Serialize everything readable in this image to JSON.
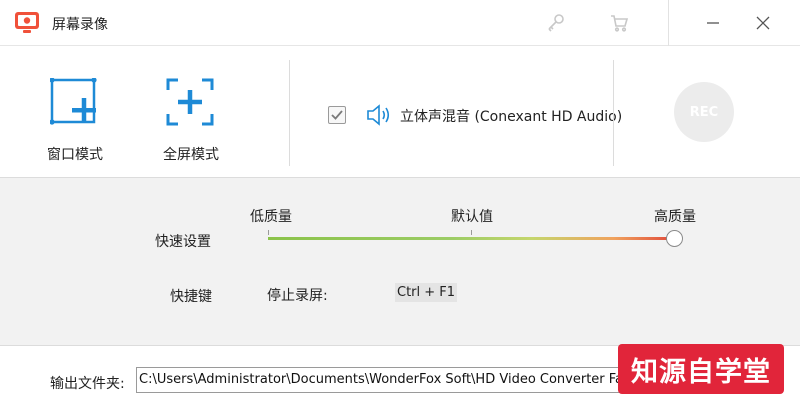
{
  "window": {
    "title": "屏幕录像",
    "icons": [
      "app-logo-icon",
      "key-icon",
      "cart-icon",
      "minimize-icon",
      "close-icon"
    ]
  },
  "modes": [
    {
      "label": "窗口模式",
      "icon": "window-mode-icon"
    },
    {
      "label": "全屏模式",
      "icon": "fullscreen-mode-icon"
    }
  ],
  "audio": {
    "checked": true,
    "device_label": "立体声混音 (Conexant HD Audio)",
    "icon": "speaker-icon"
  },
  "record_button": {
    "label": "REC"
  },
  "quality": {
    "row_label": "快速设置",
    "low_label": "低质量",
    "default_label": "默认值",
    "high_label": "高质量",
    "selected": "high"
  },
  "hotkey": {
    "row_label": "快捷键",
    "label": "停止录屏:",
    "value": "Ctrl + F1"
  },
  "output": {
    "label": "输出文件夹:",
    "path": "C:\\Users\\Administrator\\Documents\\WonderFox Soft\\HD Video Converter Factory Pro\\R"
  },
  "watermark": {
    "text": "知源自学堂"
  },
  "colors": {
    "accent": "#f0513a",
    "mode_icon": "#1e8ad6",
    "slider_low": "#8bc34a",
    "slider_high": "#e04a3a",
    "watermark_bg": "#e1253a"
  }
}
